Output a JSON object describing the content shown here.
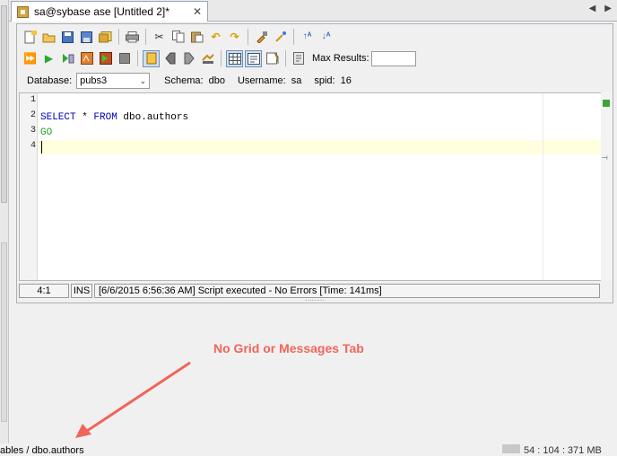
{
  "tab": {
    "title": "sa@sybase ase [Untitled 2]*",
    "close": "✕"
  },
  "nav": {
    "prev": "◀",
    "next": "▶"
  },
  "toolbar": {
    "max_results_label": "Max Results:",
    "max_results_value": ""
  },
  "connection": {
    "database_label": "Database:",
    "database_value": "pubs3",
    "schema_label": "Schema:",
    "schema_value": "dbo",
    "username_label": "Username:",
    "username_value": "sa",
    "spid_label": "spid:",
    "spid_value": "16"
  },
  "editor": {
    "line_numbers": [
      "1",
      "2",
      "3",
      "4"
    ],
    "line2_kw1": "SELECT",
    "line2_star": " * ",
    "line2_kw2": "FROM",
    "line2_rest": " dbo.authors",
    "line3": "GO"
  },
  "status": {
    "position": "4:1",
    "mode": "INS",
    "message": "[6/6/2015 6:56:36 AM] Script executed - No Errors [Time: 141ms]"
  },
  "annotation": "No Grid or Messages Tab",
  "bottom": {
    "path": "ables / dbo.authors",
    "memory": "54 : 104 : 371 MB"
  },
  "colors": {
    "keyword": "#0000c0",
    "go": "#22a122",
    "annotation": "#f0655a",
    "current_line": "#ffffe0"
  }
}
